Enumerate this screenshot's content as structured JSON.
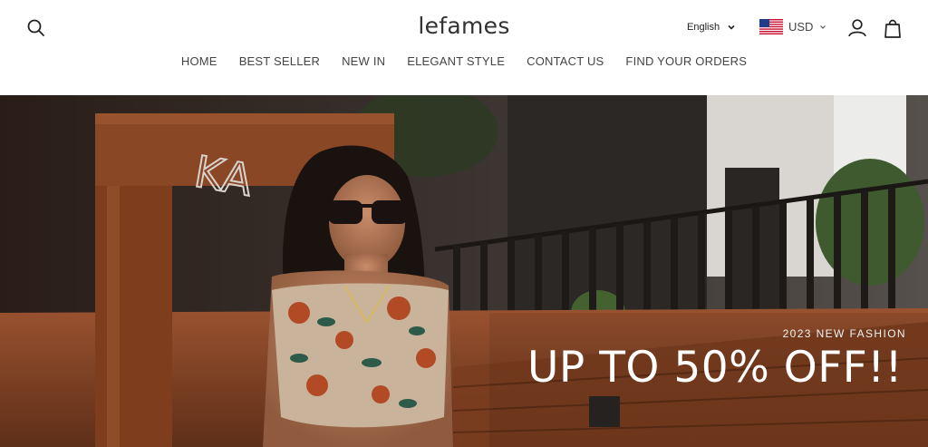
{
  "header": {
    "logo": "lefames",
    "language": "English",
    "currency": "USD",
    "icons": {
      "search": "search-icon",
      "account": "user-icon",
      "cart": "shopping-bag-icon",
      "flag": "us-flag-icon"
    }
  },
  "nav": {
    "items": [
      {
        "label": "HOME"
      },
      {
        "label": "BEST SELLER"
      },
      {
        "label": "NEW IN"
      },
      {
        "label": "ELEGANT STYLE"
      },
      {
        "label": "CONTACT US"
      },
      {
        "label": "FIND YOUR ORDERS"
      }
    ]
  },
  "hero": {
    "subtitle": "2023 NEW FASHION",
    "title": "UP TO 50% OFF!!",
    "sign_text": "KA"
  },
  "colors": {
    "text": "#222222",
    "nav_text": "#444444",
    "hero_text": "#ffffff",
    "wood": "#8a4a2a"
  }
}
